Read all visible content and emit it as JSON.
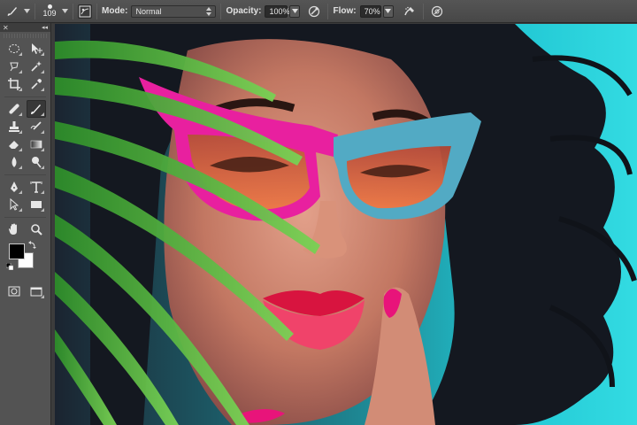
{
  "options_bar": {
    "brush_size": "109",
    "mode_label": "Mode:",
    "mode_value": "Normal",
    "opacity_label": "Opacity:",
    "opacity_value": "100%",
    "flow_label": "Flow:",
    "flow_value": "70%",
    "icons": [
      "brush-tool-icon",
      "brush-preset-icon",
      "toggle-brush-panel-icon",
      "pressure-opacity-icon",
      "airbrush-icon",
      "pressure-size-icon"
    ]
  },
  "tools_panel": {
    "close_glyph": "✕",
    "collapse_glyph": "◂◂",
    "foreground_color": "#000000",
    "background_color": "#ffffff",
    "tools": [
      [
        "elliptical-marquee",
        "move"
      ],
      [
        "lasso",
        "magic-wand"
      ],
      [
        "crop",
        "eyedropper"
      ],
      [
        "spot-healing",
        "brush"
      ],
      [
        "clone-stamp",
        "history-brush"
      ],
      [
        "eraser",
        "gradient"
      ],
      [
        "blur",
        "dodge"
      ],
      [
        "pen",
        "type"
      ],
      [
        "path-selection",
        "rectangle-shape"
      ],
      [
        "hand",
        "zoom"
      ]
    ],
    "active_tool": "brush"
  },
  "canvas": {
    "image_description_icon": "photo-canvas",
    "colors": {
      "background": "#22c6d3",
      "hair": "#141820",
      "skin": "#c98570",
      "glasses_pink": "#e81e9e",
      "glasses_blue": "#4fa9c2",
      "lenses": "#e86a3a",
      "lips": "#e01848",
      "leaf": "#4fbf3a"
    }
  }
}
